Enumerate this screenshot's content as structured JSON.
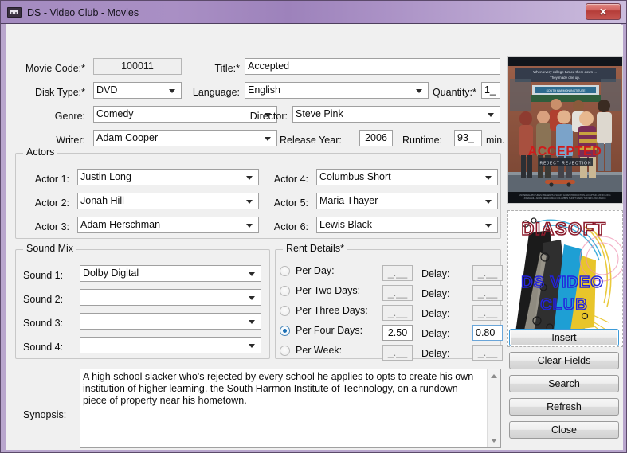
{
  "window": {
    "title": "DS - Video Club - Movies",
    "icon": "vhs-cassette-icon",
    "close_label": "✕",
    "accent_titlebar": "#a48bc0",
    "frame_color": "#b9a6cd",
    "form_background": "#f0f0f0"
  },
  "form": {
    "movie_code": {
      "label": "Movie Code:*",
      "value": "100011",
      "readonly": true
    },
    "title": {
      "label": "Title:*",
      "value": "Accepted"
    },
    "disk_type": {
      "label": "Disk Type:*",
      "value": "DVD"
    },
    "language": {
      "label": "Language:",
      "value": "English"
    },
    "quantity": {
      "label": "Quantity:*",
      "value": "1_"
    },
    "genre": {
      "label": "Genre:",
      "value": "Comedy"
    },
    "director": {
      "label": "Director:",
      "value": "Steve Pink"
    },
    "writer": {
      "label": "Writer:",
      "value": "Adam Cooper"
    },
    "release_year": {
      "label": "Release Year:",
      "value": "2006"
    },
    "runtime": {
      "label": "Runtime:",
      "value": "93_",
      "unit": "min."
    }
  },
  "actors": {
    "caption": "Actors",
    "rows": [
      {
        "label": "Actor 1:",
        "value": "Justin Long"
      },
      {
        "label": "Actor 2:",
        "value": "Jonah Hill"
      },
      {
        "label": "Actor 3:",
        "value": "Adam Herschman"
      },
      {
        "label": "Actor 4:",
        "value": "Columbus Short"
      },
      {
        "label": "Actor 5:",
        "value": "Maria Thayer"
      },
      {
        "label": "Actor 6:",
        "value": "Lewis Black"
      }
    ]
  },
  "sound_mix": {
    "caption": "Sound Mix",
    "rows": [
      {
        "label": "Sound 1:",
        "value": "Dolby Digital"
      },
      {
        "label": "Sound 2:",
        "value": ""
      },
      {
        "label": "Sound 3:",
        "value": ""
      },
      {
        "label": "Sound 4:",
        "value": ""
      }
    ]
  },
  "rent_details": {
    "caption": "Rent Details*",
    "delay_label": "Delay:",
    "mask_placeholder": "_.__",
    "selected_index": 3,
    "rows": [
      {
        "label": "Per Day:",
        "price": "_.__",
        "delay": "_.__",
        "selected": false
      },
      {
        "label": "Per Two Days:",
        "price": "_.__",
        "delay": "_.__",
        "selected": false
      },
      {
        "label": "Per Three Days:",
        "price": "_.__",
        "delay": "_.__",
        "selected": false
      },
      {
        "label": "Per Four Days:",
        "price": "2.50",
        "delay": "0.80",
        "selected": true
      },
      {
        "label": "Per Week:",
        "price": "_.__",
        "delay": "_.__",
        "selected": false
      }
    ]
  },
  "synopsis": {
    "label": "Synopsis:",
    "text": "A high school slacker who's rejected by every school he applies to opts to create his own institution of higher learning, the South Harmon Institute of Technology, on a rundown piece of property near his hometown."
  },
  "media": {
    "poster": {
      "name": "movie-poster-accepted",
      "tagline_line1": "When every college turned them down ...",
      "tagline_line2": "They made one up.",
      "marquee": "SOUTH HARMON INSTITUTE OF TECHNOLOGY",
      "main_title": "ACCEPTED",
      "subtitle": "REJECT REJECTION"
    },
    "logo": {
      "name": "diasoft-ds-video-club-logo",
      "brand": "DIASOFT",
      "line1": "DS VIDEO",
      "line2": "CLUB",
      "brand_color": "#8b1a2b",
      "text_color": "#2222dd"
    }
  },
  "buttons": [
    {
      "label": "Insert",
      "focused": true
    },
    {
      "label": "Clear Fields",
      "focused": false
    },
    {
      "label": "Search",
      "focused": false
    },
    {
      "label": "Refresh",
      "focused": false
    },
    {
      "label": "Close",
      "focused": false
    }
  ]
}
